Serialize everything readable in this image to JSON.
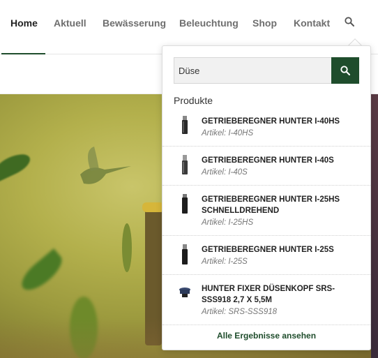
{
  "nav": {
    "items": [
      {
        "label": "Home",
        "active": true
      },
      {
        "label": "Aktuell",
        "active": false
      },
      {
        "label": "Bewässerung",
        "active": false
      },
      {
        "label": "Beleuchtung",
        "active": false
      },
      {
        "label": "Shop",
        "active": false
      },
      {
        "label": "Kontakt",
        "active": false
      }
    ],
    "search_icon": "search-icon"
  },
  "search": {
    "value": "Düse",
    "button_icon": "search-icon",
    "section_title": "Produkte",
    "results": [
      {
        "name": "GETRIEBEREGNER HUNTER I-40HS",
        "sku": "Artikel: I-40HS",
        "icon": "sprinkler-thumbnail"
      },
      {
        "name": "GETRIEBEREGNER HUNTER I-40S",
        "sku": "Artikel: I-40S",
        "icon": "sprinkler-thumbnail"
      },
      {
        "name": "GETRIEBEREGNER HUNTER I-25HS SCHNELLDREHEND",
        "sku": "Artikel: I-25HS",
        "icon": "sprinkler-thumbnail"
      },
      {
        "name": "GETRIEBEREGNER HUNTER I-25S",
        "sku": "Artikel: I-25S",
        "icon": "sprinkler-thumbnail"
      },
      {
        "name": "HUNTER FIXER DÜSENKOPF SRS-SSS918 2,7 X 5,5M",
        "sku": "Artikel: SRS-SSS918",
        "icon": "nozzle-thumbnail"
      }
    ],
    "all_results_label": "Alle Ergebnisse ansehen"
  },
  "colors": {
    "brand_green": "#1f4d2c",
    "nav_text": "#6e6e6e",
    "nav_active": "#222222"
  }
}
